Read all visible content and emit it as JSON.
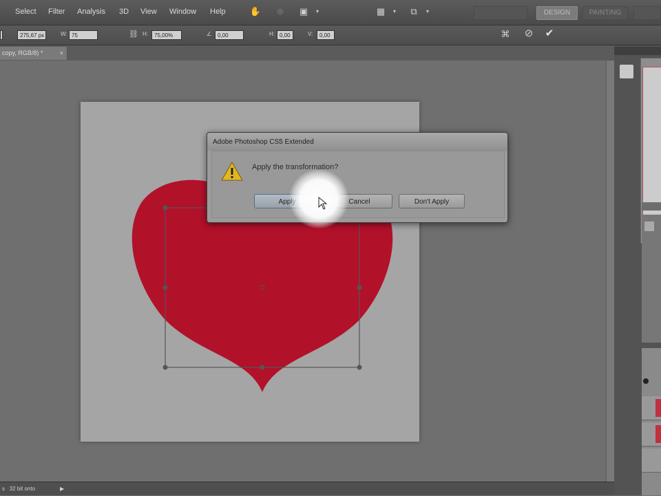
{
  "menubar": {
    "items": [
      "Select",
      "Filter",
      "Analysis",
      "3D",
      "View",
      "Window",
      "Help"
    ],
    "workspaces": [
      "DESIGN",
      "PAINTING"
    ]
  },
  "options": {
    "y_value": "275,67 px",
    "w_label": "W:",
    "w_value": "75",
    "h_label": "H:",
    "h_value": "75,00%",
    "angle_label": "∠",
    "angle_value": "0,00",
    "hskew_label": "H:",
    "hskew_value": "0,00",
    "vskew_label": "V:",
    "vskew_value": "0,00"
  },
  "document": {
    "tab_label": "copy, RGB/8) *",
    "tab_close": "×"
  },
  "status": {
    "text": "s   32 bit onto",
    "arrow": "▶"
  },
  "dialog": {
    "title": "Adobe Photoshop CS5 Extended",
    "message": "Apply the transformation?",
    "buttons": {
      "apply": "Apply",
      "cancel": "Cancel",
      "dont_apply": "Don't Apply"
    }
  },
  "colors": {
    "heart": "#b2112a",
    "canvas": "#a5a5a5",
    "workspace": "#6f6f6f"
  }
}
